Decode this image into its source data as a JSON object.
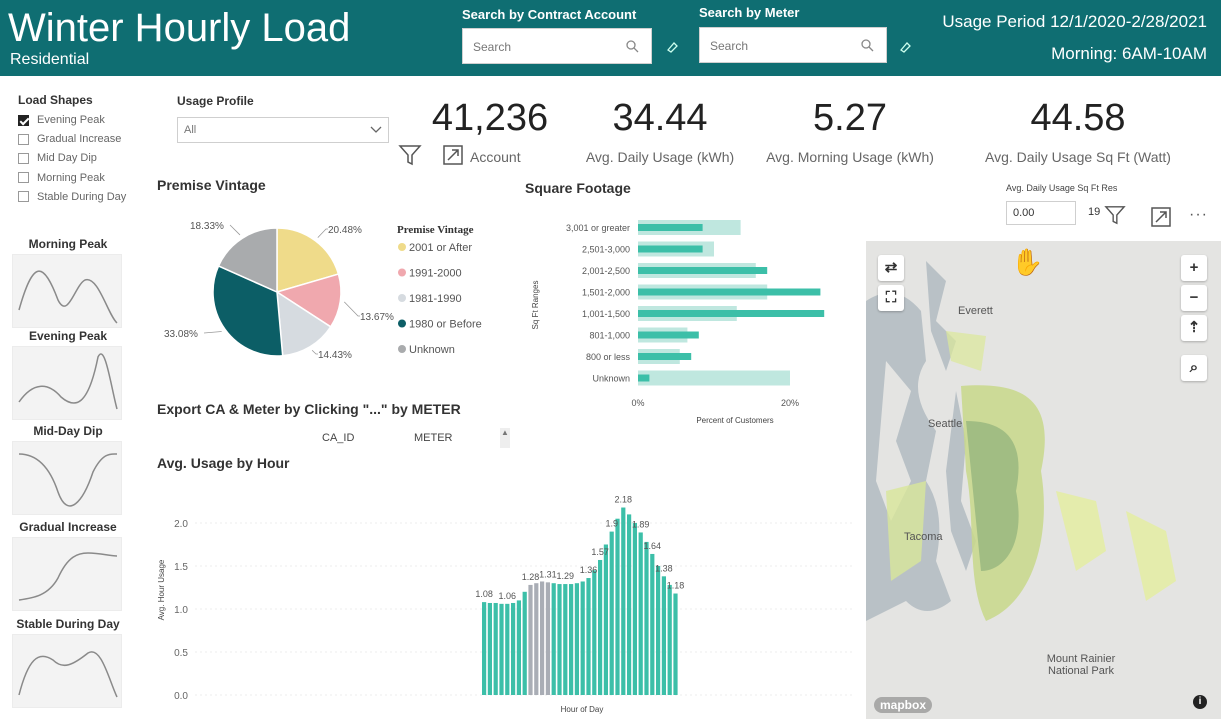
{
  "header": {
    "title": "Winter Hourly Load",
    "subtitle": "Residential",
    "search_ca_label": "Search by Contract Account",
    "search_ca_placeholder": "Search",
    "search_meter_label": "Search by Meter",
    "search_meter_placeholder": "Search",
    "usage_period": "Usage Period 12/1/2020-2/28/2021",
    "morning_window": "Morning: 6AM-10AM"
  },
  "load_shapes": {
    "title": "Load Shapes",
    "items": [
      {
        "label": "Evening Peak",
        "checked": true
      },
      {
        "label": "Gradual Increase",
        "checked": false
      },
      {
        "label": "Mid Day Dip",
        "checked": false
      },
      {
        "label": "Morning Peak",
        "checked": false
      },
      {
        "label": "Stable During Day",
        "checked": false
      }
    ]
  },
  "usage_profile": {
    "title": "Usage Profile",
    "selected": "All"
  },
  "kpis": [
    {
      "value": "41,236",
      "label": "Account"
    },
    {
      "value": "34.44",
      "label": "Avg. Daily Usage (kWh)"
    },
    {
      "value": "5.27",
      "label": "Avg. Morning Usage (kWh)"
    },
    {
      "value": "44.58",
      "label": "Avg. Daily Usage Sq Ft (Watt)"
    }
  ],
  "shape_cards": [
    {
      "title": "Morning Peak"
    },
    {
      "title": "Evening Peak"
    },
    {
      "title": "Mid-Day Dip"
    },
    {
      "title": "Gradual Increase"
    },
    {
      "title": "Stable During Day"
    }
  ],
  "premise_vintage": {
    "title": "Premise Vintage",
    "legend_title": "Premise Vintage",
    "slices": [
      {
        "label": "2001 or After",
        "pct_label": "20.48%",
        "value": 20.48,
        "color": "#efdb8a"
      },
      {
        "label": "1991-2000",
        "pct_label": "13.67%",
        "value": 13.67,
        "color": "#f0a8ae"
      },
      {
        "label": "1981-1990",
        "pct_label": "14.43%",
        "value": 14.43,
        "color": "#d6dbe0"
      },
      {
        "label": "1980 or Before",
        "pct_label": "33.08%",
        "value": 33.08,
        "color": "#0c5e66"
      },
      {
        "label": "Unknown",
        "pct_label": "18.33%",
        "value": 18.33,
        "color": "#a9abad"
      }
    ]
  },
  "square_footage": {
    "title": "Square Footage",
    "ylabel": "Sq Ft Ranges",
    "xlabel": "Percent of Customers",
    "x_ticks": [
      "0%",
      "20%"
    ],
    "categories": [
      "3,001 or greater",
      "2,501-3,000",
      "2,001-2,500",
      "1,501-2,000",
      "1,001-1,500",
      "801-1,000",
      "800 or less",
      "Unknown"
    ],
    "light_values": [
      13.5,
      10.0,
      15.5,
      17.0,
      13.0,
      6.5,
      5.5,
      20.0
    ],
    "dark_values": [
      8.5,
      8.5,
      17.0,
      24.0,
      24.5,
      8.0,
      7.0,
      1.5
    ]
  },
  "export": {
    "title": "Export CA & Meter by Clicking \"...\" by METER",
    "col1": "CA_ID",
    "col2": "METER"
  },
  "avg_usage": {
    "title": "Avg. Usage by Hour",
    "ylabel": "Avg. Hour Usage",
    "xlabel": "Hour of Day",
    "y_ticks": [
      "0.0",
      "0.5",
      "1.0",
      "1.5",
      "2.0"
    ],
    "data_labels": [
      {
        "text": "1.08",
        "x": 0,
        "y": 1.08
      },
      {
        "text": "1.06",
        "x": 4,
        "y": 1.06
      },
      {
        "text": "1.28",
        "x": 8,
        "y": 1.28
      },
      {
        "text": "1.31",
        "x": 11,
        "y": 1.31
      },
      {
        "text": "1.29",
        "x": 14,
        "y": 1.29
      },
      {
        "text": "1.36",
        "x": 18,
        "y": 1.36
      },
      {
        "text": "1.57",
        "x": 20,
        "y": 1.57
      },
      {
        "text": "1.9",
        "x": 22,
        "y": 1.9
      },
      {
        "text": "2.18",
        "x": 24,
        "y": 2.18
      },
      {
        "text": "1.89",
        "x": 27,
        "y": 1.89
      },
      {
        "text": "1.64",
        "x": 29,
        "y": 1.64
      },
      {
        "text": "1.38",
        "x": 31,
        "y": 1.38
      },
      {
        "text": "1.18",
        "x": 33,
        "y": 1.18
      }
    ]
  },
  "chart_data": [
    {
      "type": "pie",
      "title": "Premise Vintage",
      "categories": [
        "2001 or After",
        "1991-2000",
        "1981-1990",
        "1980 or Before",
        "Unknown"
      ],
      "values": [
        20.48,
        13.67,
        14.43,
        33.08,
        18.33
      ]
    },
    {
      "type": "bar",
      "title": "Square Footage",
      "xlabel": "Percent of Customers",
      "ylabel": "Sq Ft Ranges",
      "categories": [
        "3,001 or greater",
        "2,501-3,000",
        "2,001-2,500",
        "1,501-2,000",
        "1,001-1,500",
        "801-1,000",
        "800 or less",
        "Unknown"
      ],
      "series": [
        {
          "values": [
            13.5,
            10.0,
            15.5,
            17.0,
            13.0,
            6.5,
            5.5,
            20.0
          ]
        },
        {
          "values": [
            8.5,
            8.5,
            17.0,
            24.0,
            24.5,
            8.0,
            7.0,
            1.5
          ]
        }
      ],
      "xlim": [
        0,
        25
      ]
    },
    {
      "type": "bar",
      "title": "Avg. Usage by Hour",
      "xlabel": "Hour of Day",
      "ylabel": "Avg. Hour Usage",
      "ylim": [
        0,
        2.2
      ],
      "values": [
        1.08,
        1.07,
        1.07,
        1.06,
        1.06,
        1.07,
        1.1,
        1.2,
        1.28,
        1.3,
        1.32,
        1.31,
        1.3,
        1.29,
        1.29,
        1.29,
        1.3,
        1.32,
        1.36,
        1.45,
        1.57,
        1.75,
        1.9,
        2.05,
        2.18,
        2.1,
        2.0,
        1.89,
        1.78,
        1.64,
        1.5,
        1.38,
        1.28,
        1.18
      ],
      "highlight_indices": [
        8,
        9,
        10,
        11
      ]
    }
  ],
  "map": {
    "labels": [
      "Everett",
      "Seattle",
      "Tacoma",
      "Mount Rainier National Park"
    ],
    "attribution": "mapbox"
  },
  "sqft_filter": {
    "label": "Avg. Daily Usage Sq Ft Res",
    "min_value": "0.00",
    "max_value": "19"
  },
  "colors": {
    "header_bg": "#0f6e72",
    "bar_teal": "#3cbfa8",
    "bar_light": "#bfe7df",
    "bar_highlight": "#a9adb5"
  }
}
